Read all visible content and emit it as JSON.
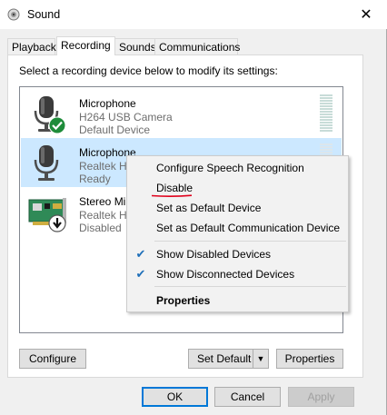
{
  "window": {
    "title": "Sound",
    "close_glyph": "✕"
  },
  "tabs": [
    {
      "label": "Playback",
      "active": false
    },
    {
      "label": "Recording",
      "active": true
    },
    {
      "label": "Sounds",
      "active": false
    },
    {
      "label": "Communications",
      "active": false
    }
  ],
  "instruction": "Select a recording device below to modify its settings:",
  "devices": [
    {
      "name": "Microphone",
      "line1": "H264 USB Camera",
      "line2": "Default Device",
      "icon": "microphone-icon",
      "badge": "green-check-badge",
      "selected": false
    },
    {
      "name": "Microphone",
      "line1": "Realtek H",
      "line2": "Ready",
      "icon": "microphone-icon",
      "badge": "",
      "selected": true
    },
    {
      "name": "Stereo Mi",
      "line1": "Realtek H",
      "line2": "Disabled",
      "icon": "sound-card-icon",
      "badge": "disabled-down-arrow-badge",
      "selected": false
    }
  ],
  "buttons": {
    "configure": "Configure",
    "set_default": "Set Default",
    "properties": "Properties",
    "ok": "OK",
    "cancel": "Cancel",
    "apply": "Apply"
  },
  "context_menu": {
    "items": [
      {
        "label": "Configure Speech Recognition",
        "checked": false,
        "bold": false
      },
      {
        "label": "Disable",
        "checked": false,
        "bold": false,
        "underlined_annotation": true
      },
      {
        "label": "Set as Default Device",
        "checked": false,
        "bold": false
      },
      {
        "label": "Set as Default Communication Device",
        "checked": false,
        "bold": false
      },
      {
        "label": "Show Disabled Devices",
        "checked": true,
        "bold": false
      },
      {
        "label": "Show Disconnected Devices",
        "checked": true,
        "bold": false
      },
      {
        "label": "Properties",
        "checked": false,
        "bold": true
      }
    ],
    "check_glyph": "✔"
  },
  "colors": {
    "selection": "#cce8ff",
    "accent": "#0078d7",
    "check_badge": "#1e8c3a",
    "annotation": "#e0001b"
  }
}
